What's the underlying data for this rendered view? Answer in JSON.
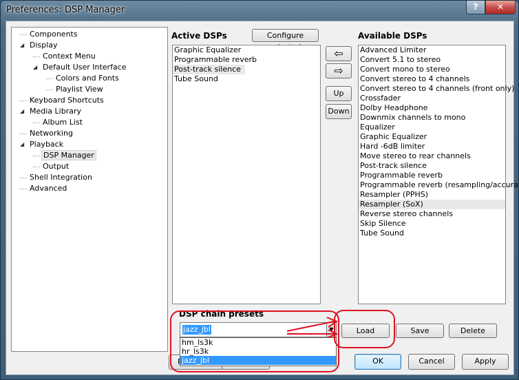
{
  "window": {
    "title": "Preferences: DSP Manager",
    "help_btn": "?",
    "close_btn": "✕"
  },
  "tree": [
    {
      "label": "Components",
      "level": 0
    },
    {
      "label": "Display",
      "level": 0,
      "expanded": true
    },
    {
      "label": "Context Menu",
      "level": 1
    },
    {
      "label": "Default User Interface",
      "level": 1,
      "expanded": true
    },
    {
      "label": "Colors and Fonts",
      "level": 2
    },
    {
      "label": "Playlist View",
      "level": 2
    },
    {
      "label": "Keyboard Shortcuts",
      "level": 0
    },
    {
      "label": "Media Library",
      "level": 0,
      "expanded": true
    },
    {
      "label": "Album List",
      "level": 1
    },
    {
      "label": "Networking",
      "level": 0
    },
    {
      "label": "Playback",
      "level": 0,
      "expanded": true
    },
    {
      "label": "DSP Manager",
      "level": 1,
      "selected": true
    },
    {
      "label": "Output",
      "level": 1
    },
    {
      "label": "Shell Integration",
      "level": 0
    },
    {
      "label": "Advanced",
      "level": 0
    }
  ],
  "active": {
    "title": "Active DSPs",
    "configure_btn": "Configure selected",
    "items": [
      "Graphic Equalizer",
      "Programmable reverb",
      "Post-track silence",
      "Tube Sound"
    ]
  },
  "available": {
    "title": "Available DSPs",
    "items": [
      "Advanced Limiter",
      "Convert 5.1 to stereo",
      "Convert mono to stereo",
      "Convert stereo to 4 channels",
      "Convert stereo to 4 channels (front only)",
      "Crossfader",
      "Dolby Headphone",
      "Downmix channels to mono",
      "Equalizer",
      "Graphic Equalizer",
      "Hard -6dB limiter",
      "Move stereo to rear channels",
      "Post-track silence",
      "Programmable reverb",
      "Programmable reverb (resampling/accurate)",
      "Resampler (PPHS)",
      "Resampler (SoX)",
      "Reverse stereo channels",
      "Skip Silence",
      "Tube Sound"
    ]
  },
  "mid_buttons": {
    "add_arrow": "⇦",
    "remove_arrow": "⇨",
    "up": "Up",
    "down": "Down"
  },
  "presets": {
    "title": "DSP chain presets",
    "current": "jazz_jbl",
    "options": [
      "hm_ls3k",
      "hr_ls3k",
      "jazz_jbl"
    ],
    "load": "Load",
    "save": "Save",
    "delete": "Delete",
    "partial_hidden_btn": "R"
  },
  "footer": {
    "ok": "OK",
    "cancel": "Cancel",
    "apply": "Apply"
  }
}
